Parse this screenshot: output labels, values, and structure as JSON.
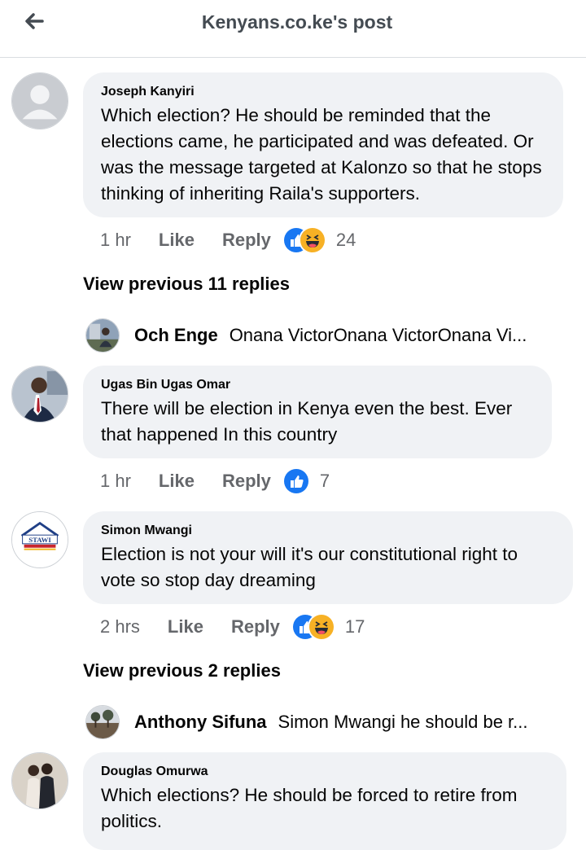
{
  "header": {
    "title": "Kenyans.co.ke's post"
  },
  "comments": [
    {
      "author": "Joseph Kanyiri",
      "text": "Which election? He should be reminded that the elections came, he participated and was defeated. Or was the message targeted at Kalonzo so that he stops thinking of inheriting Raila's supporters.",
      "time": "1 hr",
      "like": "Like",
      "reply": "Reply",
      "reactions": [
        "like",
        "haha"
      ],
      "count": "24"
    },
    {
      "author": "Ugas Bin Ugas Omar",
      "text": "There will be election in Kenya even the best. Ever that happened In this country",
      "time": "1 hr",
      "like": "Like",
      "reply": "Reply",
      "reactions": [
        "like"
      ],
      "count": "7"
    },
    {
      "author": "Simon Mwangi",
      "text": "Election is not your will it's our constitutional right to vote so stop day dreaming",
      "time": "2 hrs",
      "like": "Like",
      "reply": "Reply",
      "reactions": [
        "like",
        "haha"
      ],
      "count": "17"
    },
    {
      "author": "Douglas Omurwa",
      "text": "Which elections? He should be forced to retire from politics."
    }
  ],
  "thread1": {
    "view_previous": "View previous 11 replies",
    "reply_author": "Och Enge",
    "reply_text": "Onana VictorOnana VictorOnana Vi..."
  },
  "thread2": {
    "view_previous": "View previous 2 replies",
    "reply_author": "Anthony Sifuna",
    "reply_text": "Simon Mwangi he should be r..."
  },
  "avatar_logo_text": "STAWI",
  "colors": {
    "like_blue": "#1877f2",
    "haha_yellow": "#f7b125",
    "bubble": "#f0f2f5",
    "meta_gray": "#65676b"
  }
}
